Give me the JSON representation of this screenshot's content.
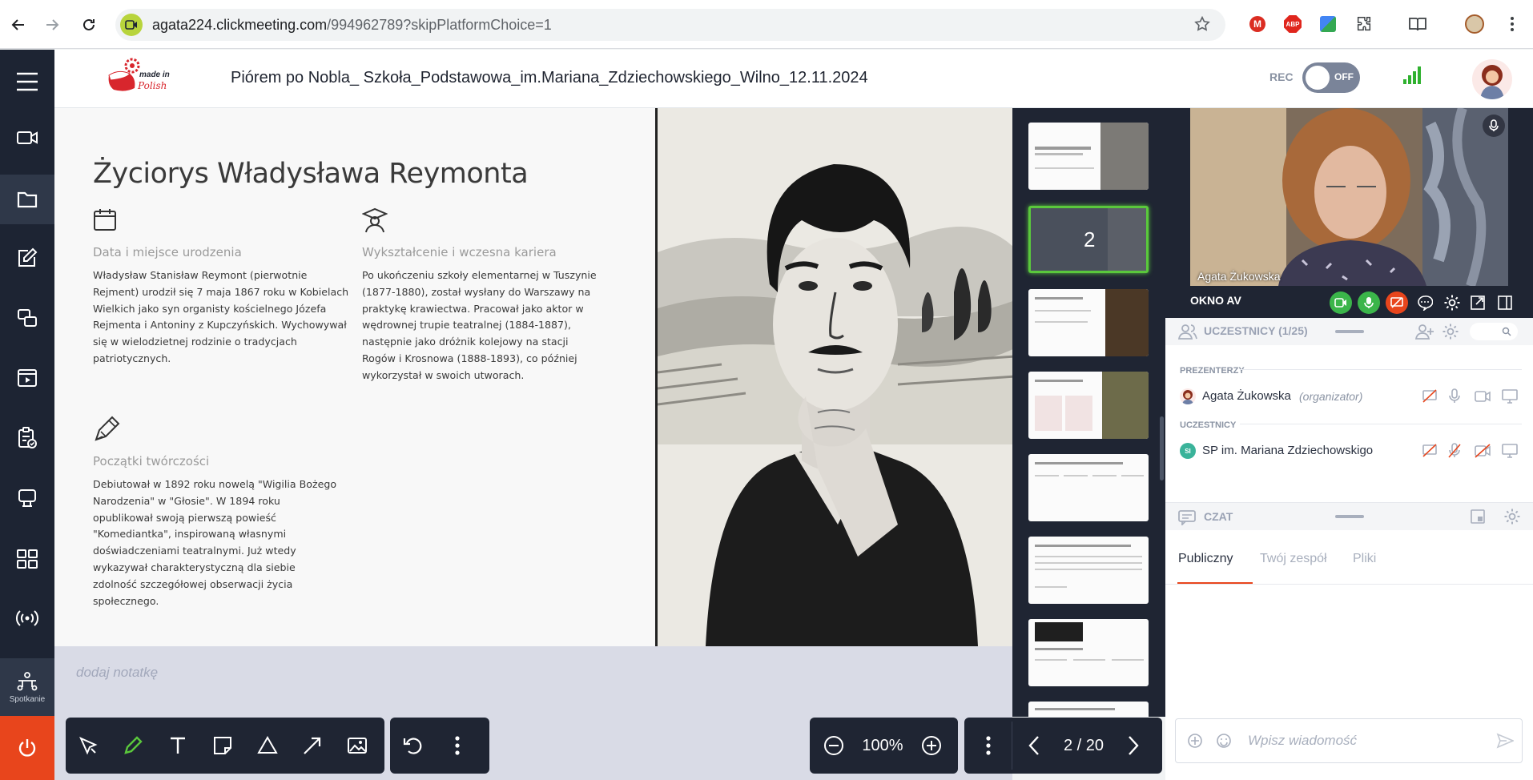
{
  "browser": {
    "url_host": "agata224.clickmeeting.com",
    "url_path": "/994962789?skipPlatformChoice=1",
    "ext_abp": "ABP"
  },
  "header": {
    "logo_text_line1": "made in",
    "logo_text_line2": "Polish",
    "title": "Piórem po Nobla_ Szkoła_Podstawowa_im.Mariana_Zdziechowskiego_Wilno_12.11.2024",
    "rec_label": "REC",
    "rec_toggle_state": "OFF"
  },
  "sidebar": {
    "meeting_label": "Spotkanie"
  },
  "slide": {
    "title": "Życiorys Władysława Reymonta",
    "sections": [
      {
        "heading": "Data i miejsce urodzenia",
        "icon": "calendar-icon",
        "body": "Władysław Stanisław Reymont (pierwotnie Rejment) urodził się 7 maja 1867 roku w Kobielach Wielkich jako syn organisty kościelnego Józefa Rejmenta i Antoniny z Kupczyńskich. Wychowywał się w wielodzietnej rodzinie o tradycjach patriotycznych."
      },
      {
        "heading": "Wykształcenie i wczesna kariera",
        "icon": "graduate-icon",
        "body": "Po ukończeniu szkoły elementarnej w Tuszynie (1877-1880), został wysłany do Warszawy na praktykę krawiectwa. Pracował jako aktor w wędrownej trupie teatralnej (1884-1887), następnie jako dróżnik kolejowy na stacji Rogów i Krosnowa (1888-1893), co później wykorzystał w swoich utworach."
      },
      {
        "heading": "Początki twórczości",
        "icon": "pen-icon",
        "body": "Debiutował w 1892 roku nowelą \"Wigilia Bożego Narodzenia\" w \"Głosie\". W 1894 roku opublikował swoją pierwszą powieść \"Komediantka\", inspirowaną własnymi doświadczeniami teatralnymi. Już wtedy wykazywał charakterystyczną dla siebie zdolność szczegółowej obserwacji życia społecznego."
      }
    ]
  },
  "notes": {
    "placeholder": "dodaj notatkę"
  },
  "zoom": {
    "value": "100%"
  },
  "pagination": {
    "label": "2 / 20"
  },
  "thumbnails": {
    "active_number": "2"
  },
  "video": {
    "name": "Agata Żukowska",
    "window_label": "OKNO AV"
  },
  "participants": {
    "title": "UCZESTNICY (1/25)",
    "presenters_label": "PREZENTERZY",
    "participants_label": "UCZESTNICY",
    "presenter": {
      "name": "Agata Żukowska",
      "role": "(organizator)"
    },
    "attendee": {
      "initials": "SI",
      "name": "SP im. Mariana Zdziechowskigo"
    }
  },
  "chat": {
    "title": "CZAT",
    "tabs": [
      "Publiczny",
      "Twój zespół",
      "Pliki"
    ],
    "input_placeholder": "Wpisz wiadomość"
  },
  "colors": {
    "sidebar_bg": "#1d2433",
    "power_bg": "#e8451c",
    "active_thumb": "#5ac83c",
    "accent": "#e8451c"
  }
}
